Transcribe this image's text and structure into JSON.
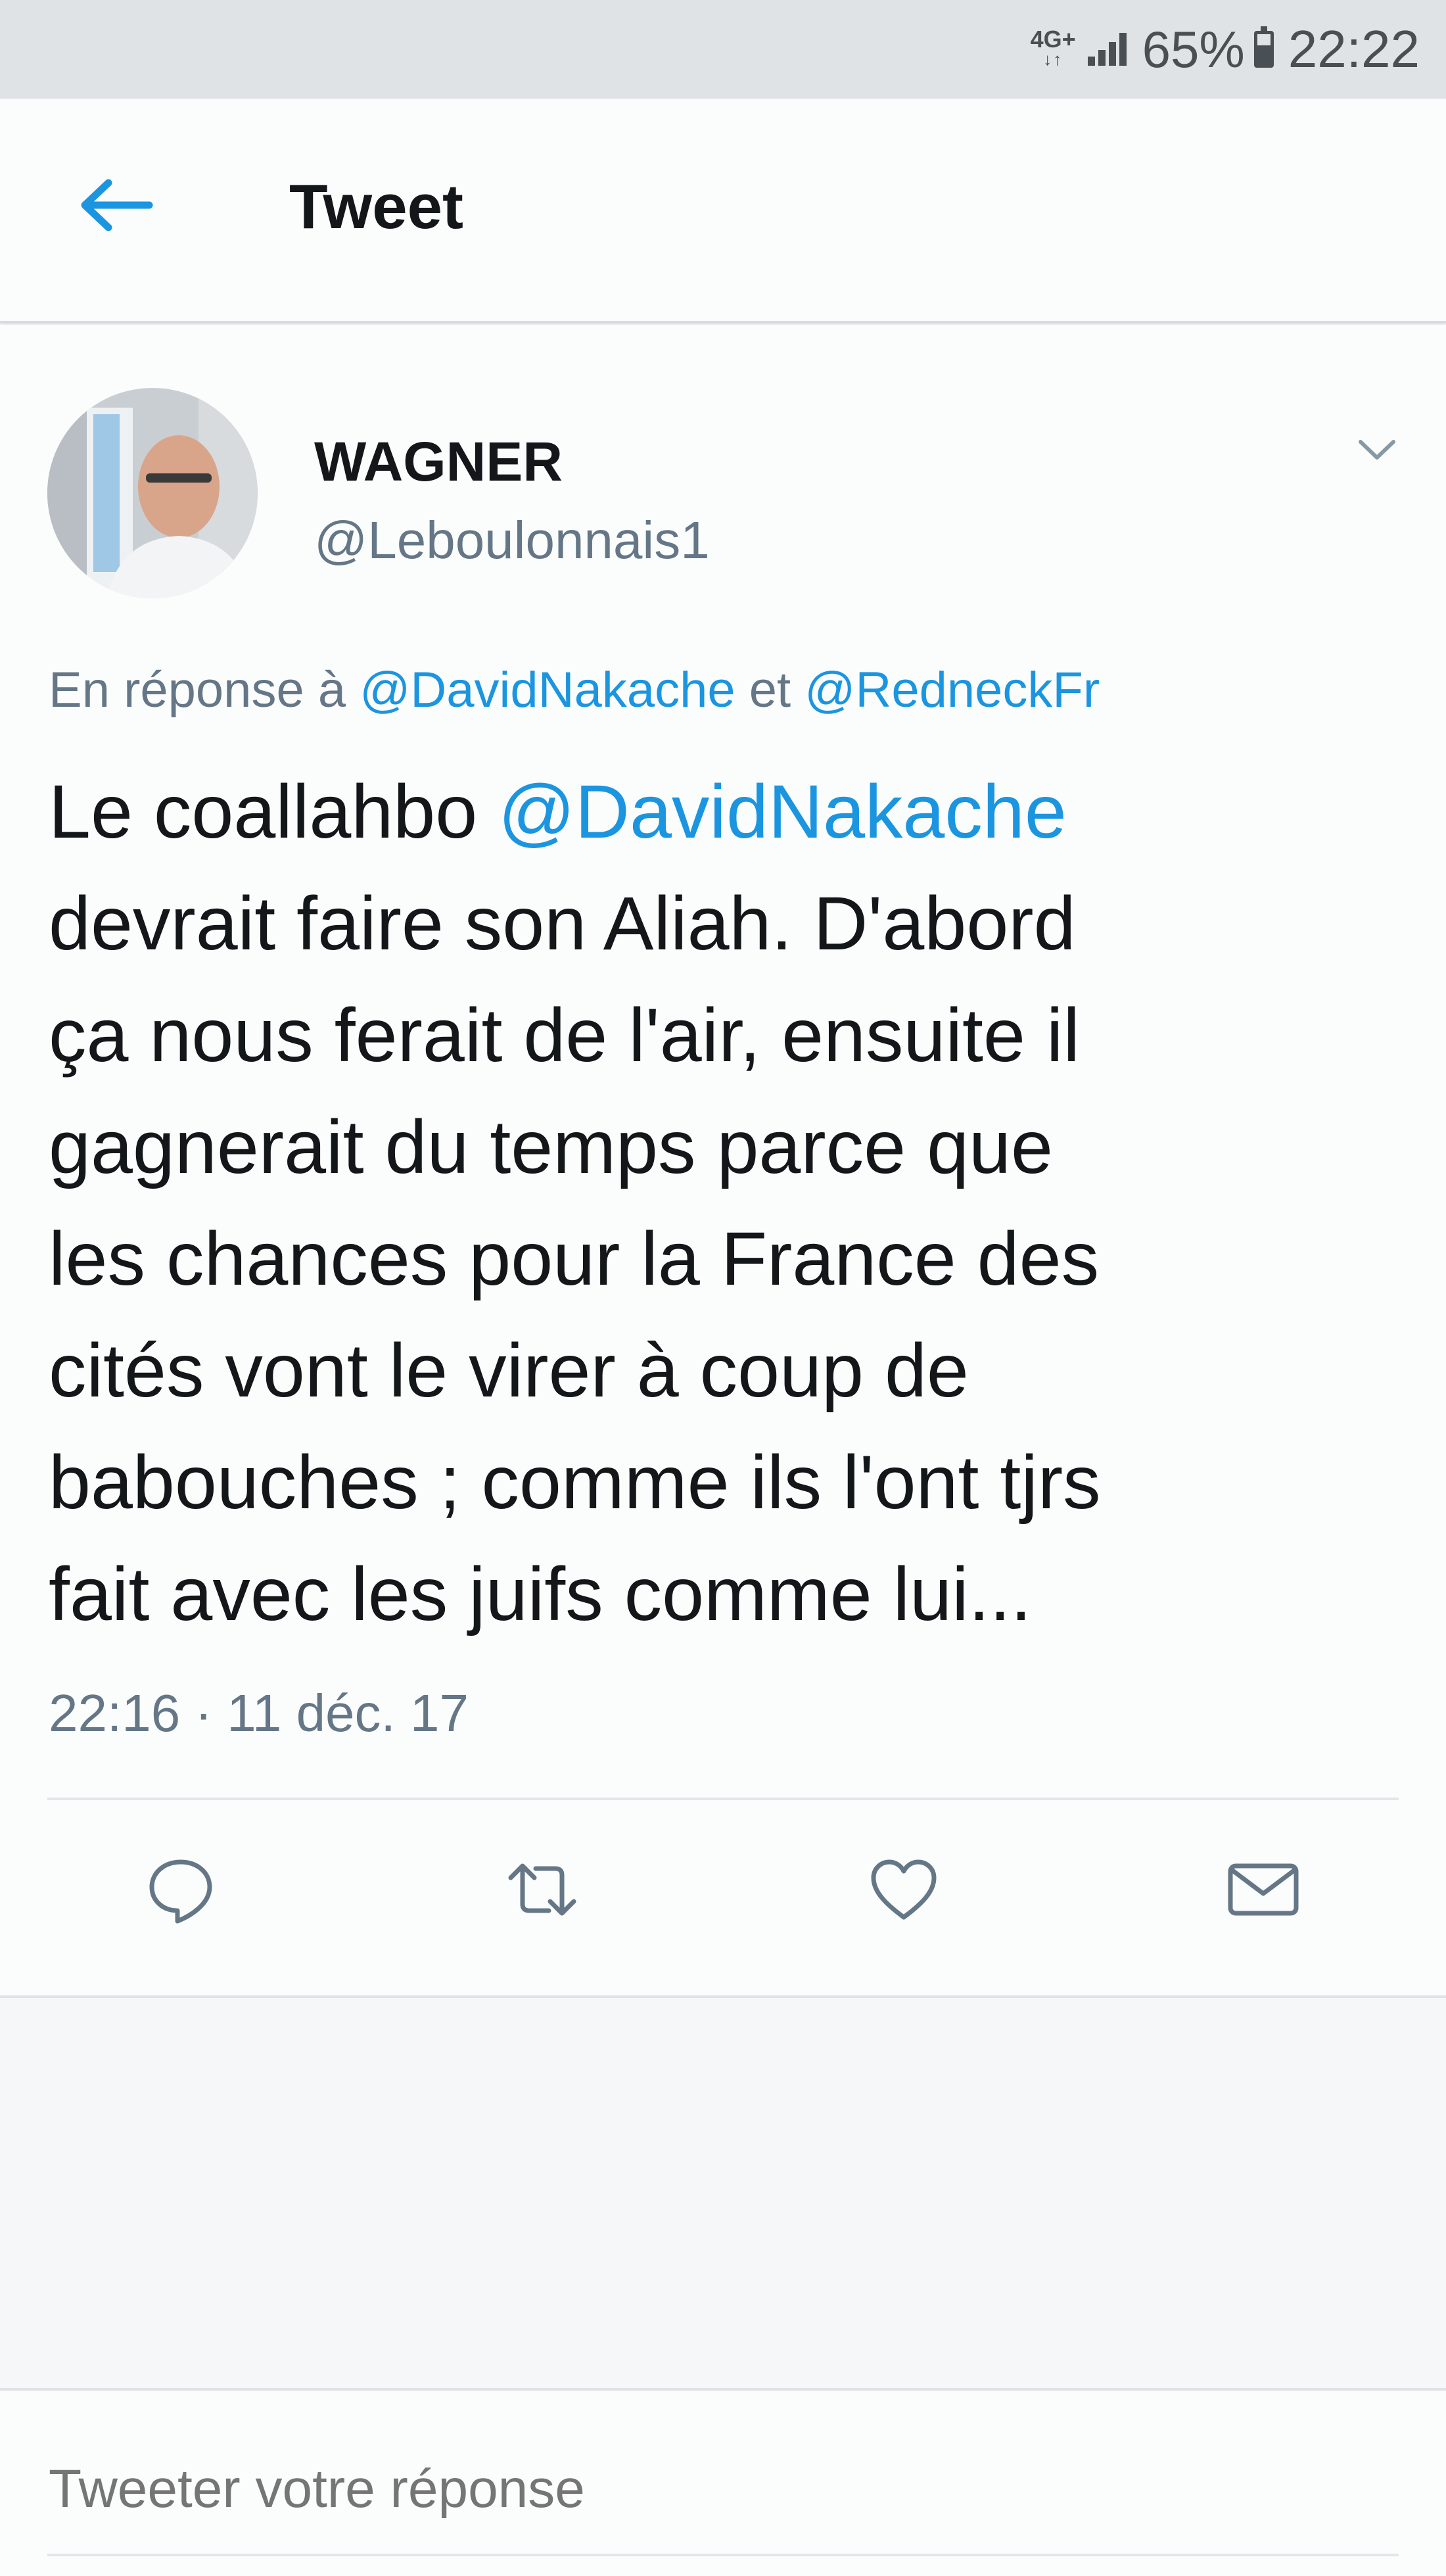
{
  "status_bar": {
    "network": "4G+",
    "network_arrows": "↓↑",
    "battery": "65%",
    "time": "22:22"
  },
  "header": {
    "title": "Tweet",
    "back_icon": "arrow-left-icon"
  },
  "tweet": {
    "author": {
      "display_name": "WAGNER",
      "handle": "@Leboulonnais1"
    },
    "reply_to": {
      "prefix": "En réponse à",
      "mention1": "@DavidNakache",
      "conjunction": "et",
      "mention2": "@RedneckFr"
    },
    "text": {
      "line1_before": "Le coallahbo",
      "line1_mention": "@DavidNakache",
      "line2": "devrait faire son Aliah. D'abord",
      "line3": "ça nous ferait de l'air, ensuite il",
      "line4": "gagnerait du temps parce que",
      "line5": "les chances pour la France des",
      "line6": "cités vont le virer à coup de",
      "line7": "babouches ; comme ils l'ont tjrs",
      "line8": "fait avec les juifs comme lui..."
    },
    "timestamp": "22:16 · 11 déc. 17",
    "actions": [
      "reply-icon",
      "retweet-icon",
      "like-icon",
      "direct-message-icon"
    ]
  },
  "reply_box": {
    "placeholder": "Tweeter votre réponse"
  },
  "colors": {
    "accent": "#1b95e0",
    "muted_text": "#657786",
    "primary_text": "#14171a"
  }
}
